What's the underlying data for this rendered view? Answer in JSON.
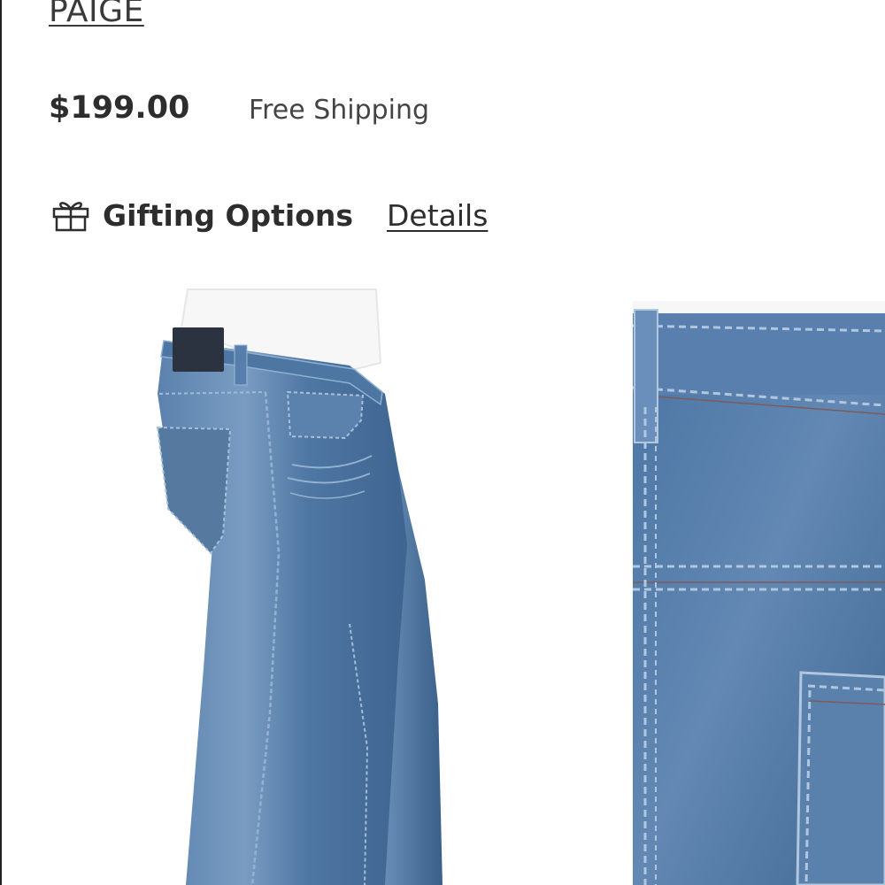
{
  "product": {
    "brand": "PAIGE",
    "price": "$199.00",
    "shipping": "Free Shipping"
  },
  "gifting": {
    "icon": "gift-icon",
    "label": "Gifting Options",
    "details_link": "Details"
  },
  "colors": {
    "text": "#333333",
    "denim": "#4a74a3",
    "denim_dark": "#3b5f8a",
    "denim_light": "#7fa3c8",
    "shirt": "#ffffff"
  }
}
